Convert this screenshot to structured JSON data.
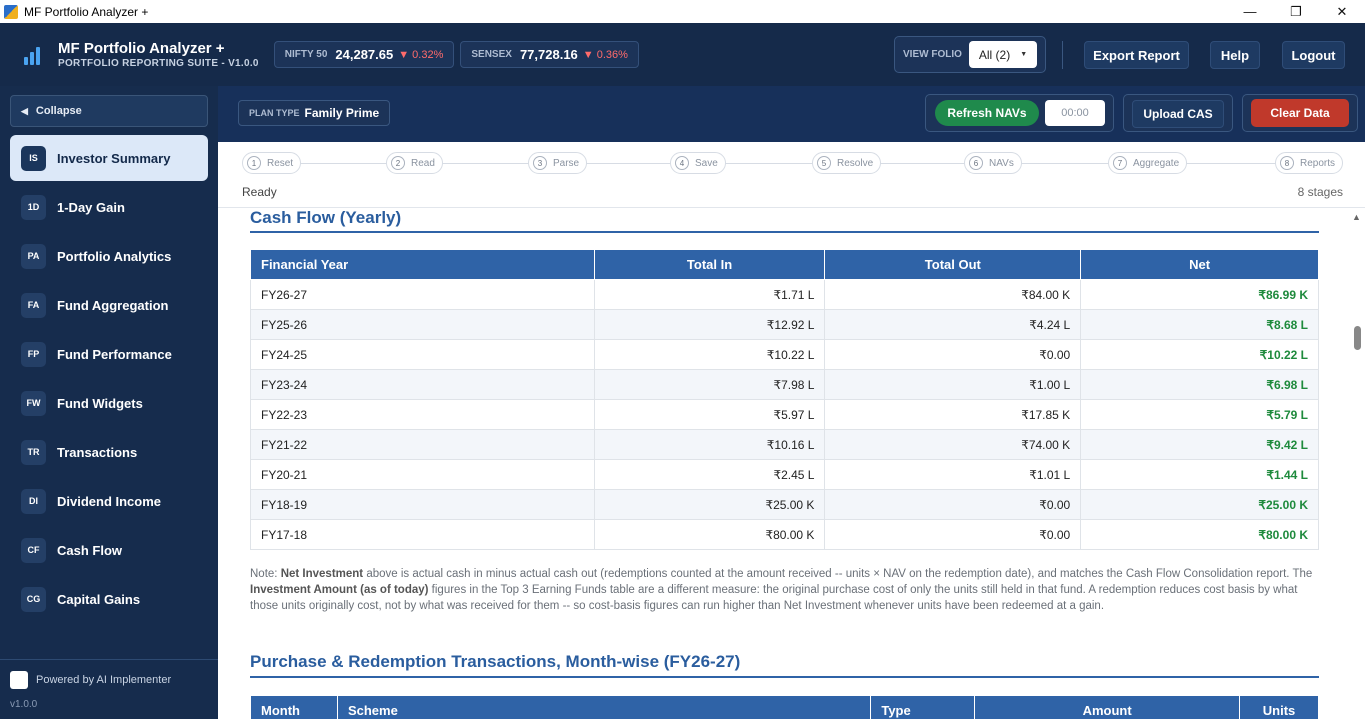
{
  "window": {
    "title": "MF Portfolio Analyzer +",
    "min": "—",
    "max": "❐",
    "close": "✕"
  },
  "brand": {
    "title": "MF Portfolio Analyzer +",
    "subtitle": "PORTFOLIO REPORTING SUITE - V1.0.0"
  },
  "tickers": [
    {
      "name": "NIFTY 50",
      "value": "24,287.65",
      "change": "▼ 0.32%"
    },
    {
      "name": "SENSEX",
      "value": "77,728.16",
      "change": "▼ 0.36%"
    }
  ],
  "folio": {
    "label": "VIEW FOLIO",
    "selected": "All (2)"
  },
  "header_buttons": {
    "export": "Export Report",
    "help": "Help",
    "logout": "Logout"
  },
  "plan": {
    "label": "PLAN TYPE",
    "value": "Family Prime"
  },
  "actions": {
    "refresh": "Refresh NAVs",
    "timer": "00:00",
    "upload": "Upload CAS",
    "clear": "Clear Data"
  },
  "sidebar": {
    "collapse": "Collapse",
    "items": [
      {
        "abbr": "IS",
        "label": "Investor Summary"
      },
      {
        "abbr": "1D",
        "label": "1-Day Gain"
      },
      {
        "abbr": "PA",
        "label": "Portfolio Analytics"
      },
      {
        "abbr": "FA",
        "label": "Fund Aggregation"
      },
      {
        "abbr": "FP",
        "label": "Fund Performance"
      },
      {
        "abbr": "FW",
        "label": "Fund Widgets"
      },
      {
        "abbr": "TR",
        "label": "Transactions"
      },
      {
        "abbr": "DI",
        "label": "Dividend Income"
      },
      {
        "abbr": "CF",
        "label": "Cash Flow"
      },
      {
        "abbr": "CG",
        "label": "Capital Gains"
      }
    ],
    "powered": "Powered by AI Implementer",
    "version": "v1.0.0"
  },
  "stepper": {
    "steps": [
      {
        "n": "1",
        "label": "Reset"
      },
      {
        "n": "2",
        "label": "Read"
      },
      {
        "n": "3",
        "label": "Parse"
      },
      {
        "n": "4",
        "label": "Save"
      },
      {
        "n": "5",
        "label": "Resolve"
      },
      {
        "n": "6",
        "label": "NAVs"
      },
      {
        "n": "7",
        "label": "Aggregate"
      },
      {
        "n": "8",
        "label": "Reports"
      }
    ],
    "status": "Ready",
    "count": "8 stages"
  },
  "cashflow": {
    "title": "Cash Flow (Yearly)",
    "headers": [
      "Financial Year",
      "Total In",
      "Total Out",
      "Net"
    ],
    "rows": [
      [
        "FY26-27",
        "₹1.71 L",
        "₹84.00 K",
        "₹86.99 K"
      ],
      [
        "FY25-26",
        "₹12.92 L",
        "₹4.24 L",
        "₹8.68 L"
      ],
      [
        "FY24-25",
        "₹10.22 L",
        "₹0.00",
        "₹10.22 L"
      ],
      [
        "FY23-24",
        "₹7.98 L",
        "₹1.00 L",
        "₹6.98 L"
      ],
      [
        "FY22-23",
        "₹5.97 L",
        "₹17.85 K",
        "₹5.79 L"
      ],
      [
        "FY21-22",
        "₹10.16 L",
        "₹74.00 K",
        "₹9.42 L"
      ],
      [
        "FY20-21",
        "₹2.45 L",
        "₹1.01 L",
        "₹1.44 L"
      ],
      [
        "FY18-19",
        "₹25.00 K",
        "₹0.00",
        "₹25.00 K"
      ],
      [
        "FY17-18",
        "₹80.00 K",
        "₹0.00",
        "₹80.00 K"
      ]
    ],
    "note": {
      "p1": "Note: ",
      "b1": "Net Investment",
      "p2": " above is actual cash in minus actual cash out (redemptions counted at the amount received -- units × NAV on the redemption date), and matches the Cash Flow Consolidation report. The ",
      "b2": "Investment Amount (as of today)",
      "p3": " figures in the Top 3 Earning Funds table are a different measure: the original purchase cost of only the units still held in that fund. A redemption reduces cost basis by what those units originally cost, not by what was received for them -- so cost-basis figures can run higher than Net Investment whenever units have been redeemed at a gain."
    }
  },
  "transactions": {
    "title": "Purchase & Redemption Transactions, Month-wise (FY26-27)",
    "headers": [
      "Month",
      "Scheme",
      "Type",
      "Amount",
      "Units"
    ]
  }
}
